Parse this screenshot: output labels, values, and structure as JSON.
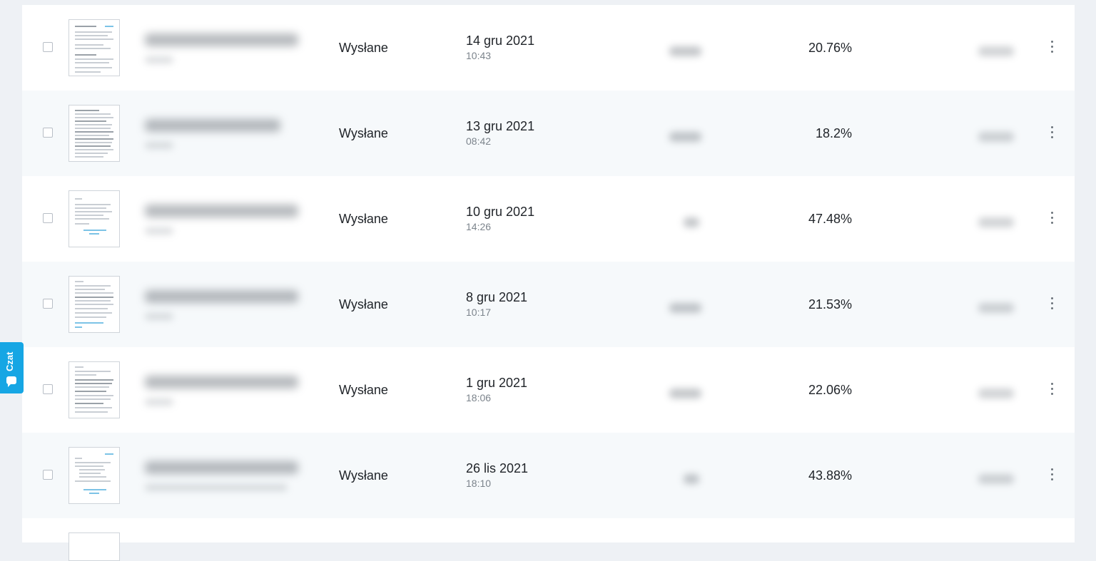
{
  "rows": [
    {
      "status": "Wysłane",
      "date": "14 gru 2021",
      "time": "10:43",
      "percent": "20.76%",
      "alt": false
    },
    {
      "status": "Wysłane",
      "date": "13 gru 2021",
      "time": "08:42",
      "percent": "18.2%",
      "alt": true
    },
    {
      "status": "Wysłane",
      "date": "10 gru 2021",
      "time": "14:26",
      "percent": "47.48%",
      "alt": false
    },
    {
      "status": "Wysłane",
      "date": "8 gru 2021",
      "time": "10:17",
      "percent": "21.53%",
      "alt": true
    },
    {
      "status": "Wysłane",
      "date": "1 gru 2021",
      "time": "18:06",
      "percent": "22.06%",
      "alt": false
    },
    {
      "status": "Wysłane",
      "date": "26 lis 2021",
      "time": "18:10",
      "percent": "43.88%",
      "alt": true
    }
  ],
  "chat": {
    "label": "Czat"
  },
  "colors": {
    "accent": "#16a6e4",
    "row_alt": "#f6f9fb",
    "page_bg": "#eef1f5"
  }
}
